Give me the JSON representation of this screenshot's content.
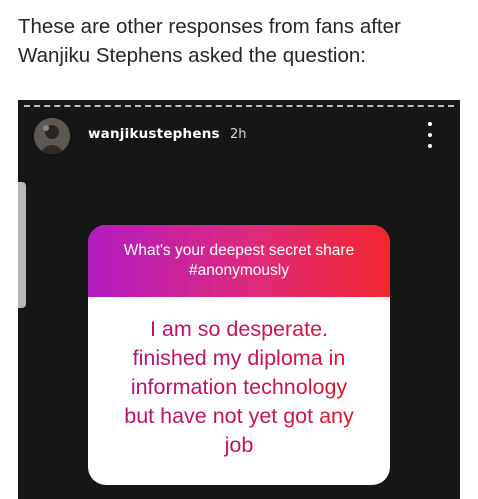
{
  "article": {
    "paragraph": "These are other responses from fans after Wanjiku Stephens asked the question:"
  },
  "story": {
    "username": "wanjikustephens",
    "time": "2h",
    "question_sticker": {
      "prompt": "What's your deepest secret share\n#anonymously",
      "answer": "I am so desperate.\nfinished my diploma in\ninformation technology\nbut have not yet got any\njob"
    }
  },
  "icons": {
    "more": "vertical-ellipsis-icon",
    "avatar": "profile-photo"
  },
  "colors": {
    "story_background": "#161616",
    "sticker_gradient_start": "#b11cc2",
    "sticker_gradient_end": "#f2262e",
    "answer_text": "#c0135a"
  }
}
